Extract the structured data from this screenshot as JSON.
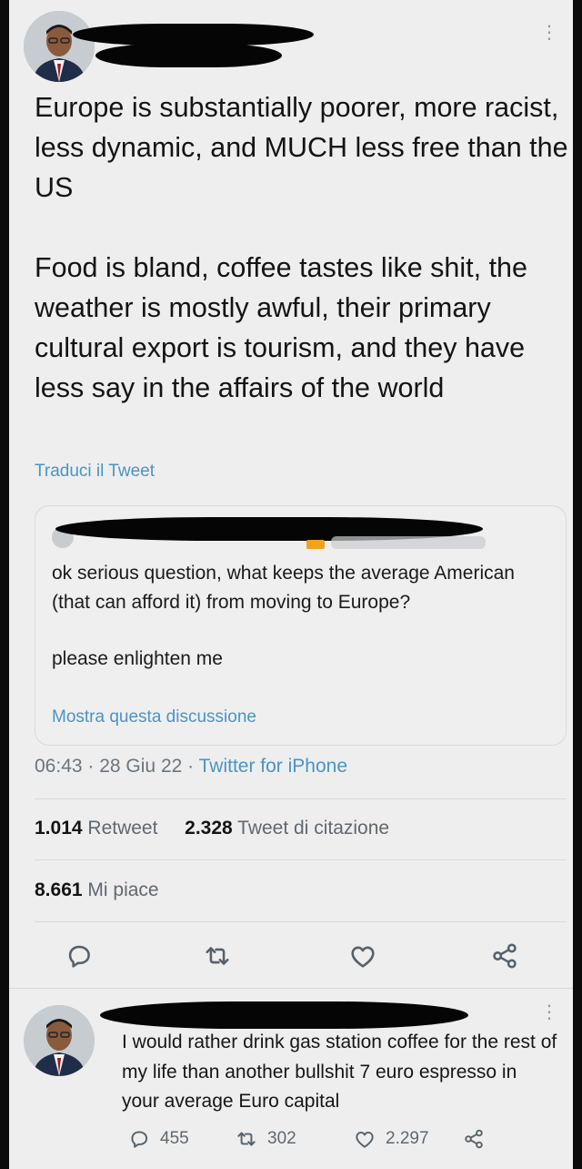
{
  "tweet": {
    "paragraphs": [
      "Europe is substantially poorer, more racist, less dynamic, and MUCH less free than the US",
      "Food is bland, coffee tastes like shit, the weather is mostly awful, their primary cultural export is tourism, and they have less say in the affairs of the world"
    ],
    "translate_label": "Traduci il Tweet",
    "time": "06:43",
    "date": "28 Giu 22",
    "source": "Twitter for iPhone",
    "retweets_count": "1.014",
    "retweets_label": "Retweet",
    "quotes_count": "2.328",
    "quotes_label": "Tweet di citazione",
    "likes_count": "8.661",
    "likes_label": "Mi piace",
    "actions": [
      "reply-icon",
      "retweet-icon",
      "like-icon",
      "share-icon"
    ]
  },
  "quoted_tweet": {
    "paragraphs": [
      "ok serious question, what keeps the average American (that can afford it) from moving to Europe?",
      "please enlighten me"
    ],
    "show_thread_label": "Mostra questa discussione"
  },
  "reply": {
    "text": "I would rather drink gas station coffee for the rest of my life than another bullshit 7 euro espresso in your average Euro capital",
    "replies": "455",
    "retweets": "302",
    "likes": "2.297"
  },
  "colors": {
    "link": "#4a94c4",
    "background": "#eeeeef",
    "muted": "#6b757d"
  }
}
